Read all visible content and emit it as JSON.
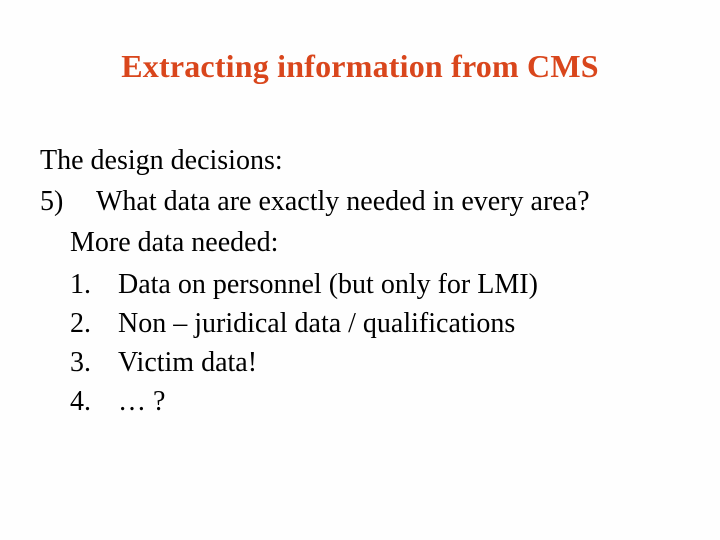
{
  "title": "Extracting information from CMS",
  "intro": "The design decisions:",
  "question": {
    "marker": "5)",
    "text": "What data are exactly needed in every area?"
  },
  "sub_intro": "More data needed:",
  "items": [
    {
      "marker": "1.",
      "text": "Data on personnel (but only for LMI)"
    },
    {
      "marker": "2.",
      "text": "Non – juridical data / qualifications"
    },
    {
      "marker": "3.",
      "text": "Victim data!"
    },
    {
      "marker": "4.",
      "text": "… ?"
    }
  ]
}
